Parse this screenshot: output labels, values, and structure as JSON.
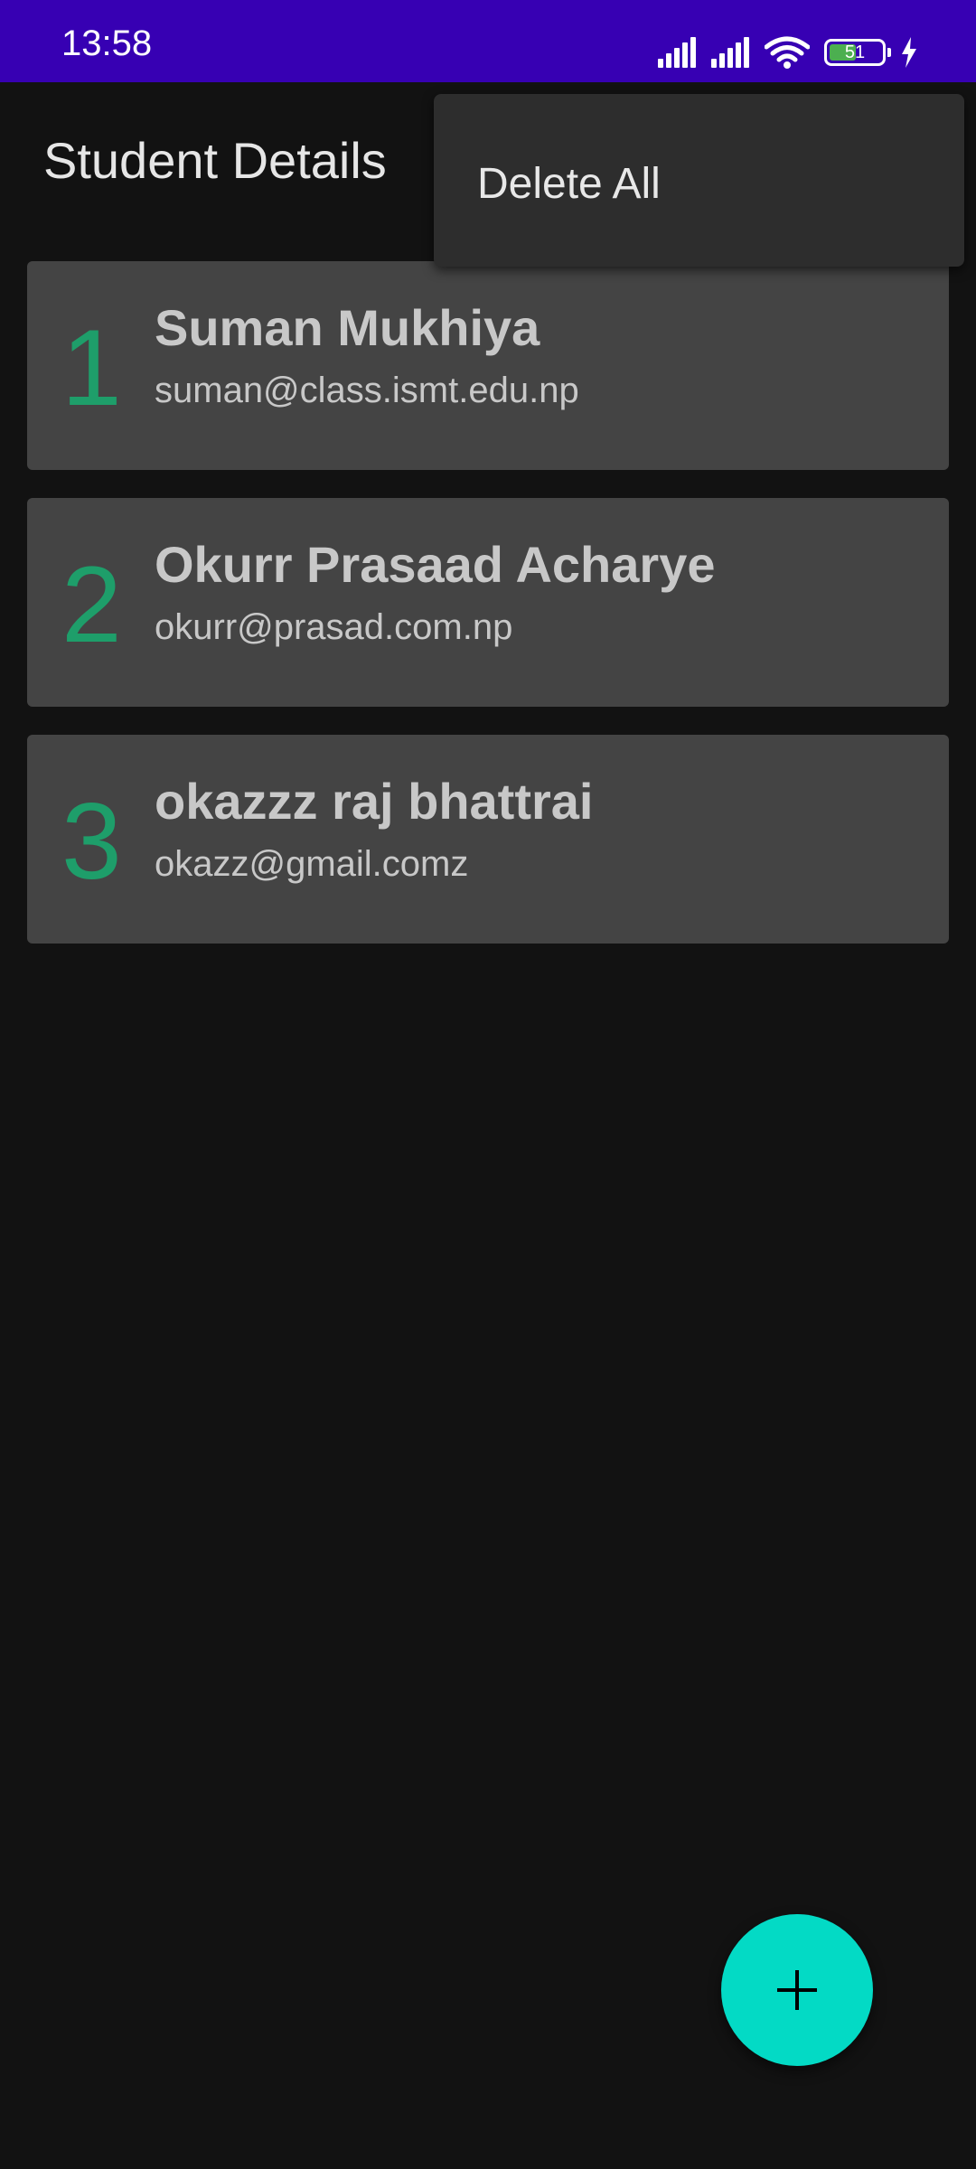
{
  "status_bar": {
    "time": "13:58",
    "battery_level": "51",
    "battery_fraction": 0.51,
    "icons": [
      "signal-icon",
      "signal-icon",
      "wifi-icon",
      "battery-icon",
      "charging-icon"
    ]
  },
  "app_bar": {
    "title": "Student Details"
  },
  "overflow_menu": {
    "items": [
      {
        "label": "Delete All"
      }
    ]
  },
  "students": [
    {
      "number": "1",
      "name": "Suman Mukhiya",
      "email": "suman@class.ismt.edu.np"
    },
    {
      "number": "2",
      "name": "Okurr Prasaad Acharye",
      "email": "okurr@prasad.com.np"
    },
    {
      "number": "3",
      "name": "okazzz raj bhattrai",
      "email": "okazz@gmail.comz"
    }
  ],
  "fab": {
    "icon": "plus-icon"
  },
  "colors": {
    "status_bar": "#3700b3",
    "background": "#121212",
    "card": "#444444",
    "number": "#1e9e6a",
    "fab": "#03dac5",
    "menu": "#2d2d2d"
  }
}
